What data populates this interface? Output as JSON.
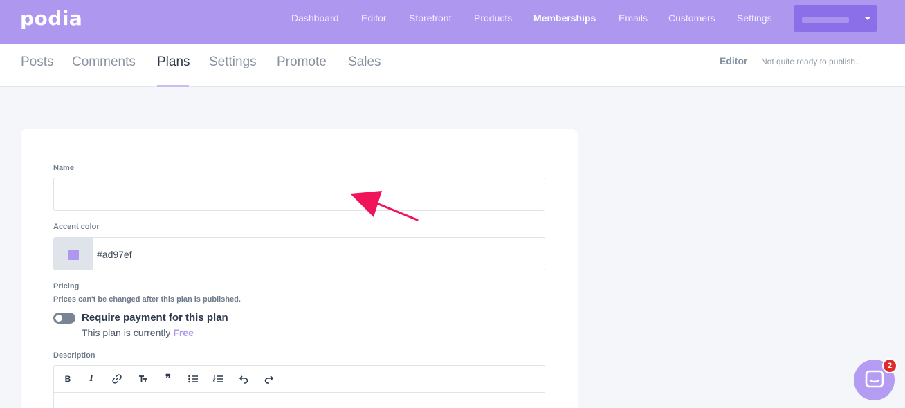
{
  "brand": {
    "logo": "podia",
    "accent": "#ad97ef"
  },
  "topnav": {
    "items": [
      {
        "label": "Dashboard"
      },
      {
        "label": "Editor"
      },
      {
        "label": "Storefront"
      },
      {
        "label": "Products"
      },
      {
        "label": "Memberships",
        "active": true
      },
      {
        "label": "Emails"
      },
      {
        "label": "Customers"
      },
      {
        "label": "Settings"
      }
    ],
    "account_icon": "chevron-down-icon"
  },
  "subnav": {
    "tabs": [
      {
        "label": "Posts"
      },
      {
        "label": "Comments"
      },
      {
        "label": "Plans",
        "active": true
      },
      {
        "label": "Settings"
      },
      {
        "label": "Promote"
      },
      {
        "label": "Sales"
      }
    ],
    "editor_label": "Editor",
    "publish_note": "Not quite ready to publish..."
  },
  "form": {
    "name": {
      "label": "Name",
      "value": ""
    },
    "accent_color": {
      "label": "Accent color",
      "value": "#ad97ef"
    },
    "pricing": {
      "label": "Pricing",
      "help": "Prices can't be changed after this plan is published.",
      "toggle_label": "Require payment for this plan",
      "toggle_on": false,
      "status_prefix": "This plan is currently",
      "status_value": "Free"
    },
    "description": {
      "label": "Description",
      "toolbar": [
        {
          "icon": "bold-icon",
          "glyph": "B"
        },
        {
          "icon": "italic-icon",
          "glyph": "I"
        },
        {
          "icon": "link-icon",
          "glyph": ""
        },
        {
          "icon": "heading-icon",
          "glyph": ""
        },
        {
          "icon": "quote-icon",
          "glyph": "❞"
        },
        {
          "icon": "bullet-list-icon",
          "glyph": ""
        },
        {
          "icon": "numbered-list-icon",
          "glyph": ""
        },
        {
          "icon": "undo-icon",
          "glyph": ""
        },
        {
          "icon": "redo-icon",
          "glyph": ""
        }
      ]
    }
  },
  "annotation": {
    "icon": "pointer-arrow-icon",
    "color": "#f0145a"
  },
  "chat": {
    "icon": "chat-icon",
    "badge_count": "2"
  }
}
